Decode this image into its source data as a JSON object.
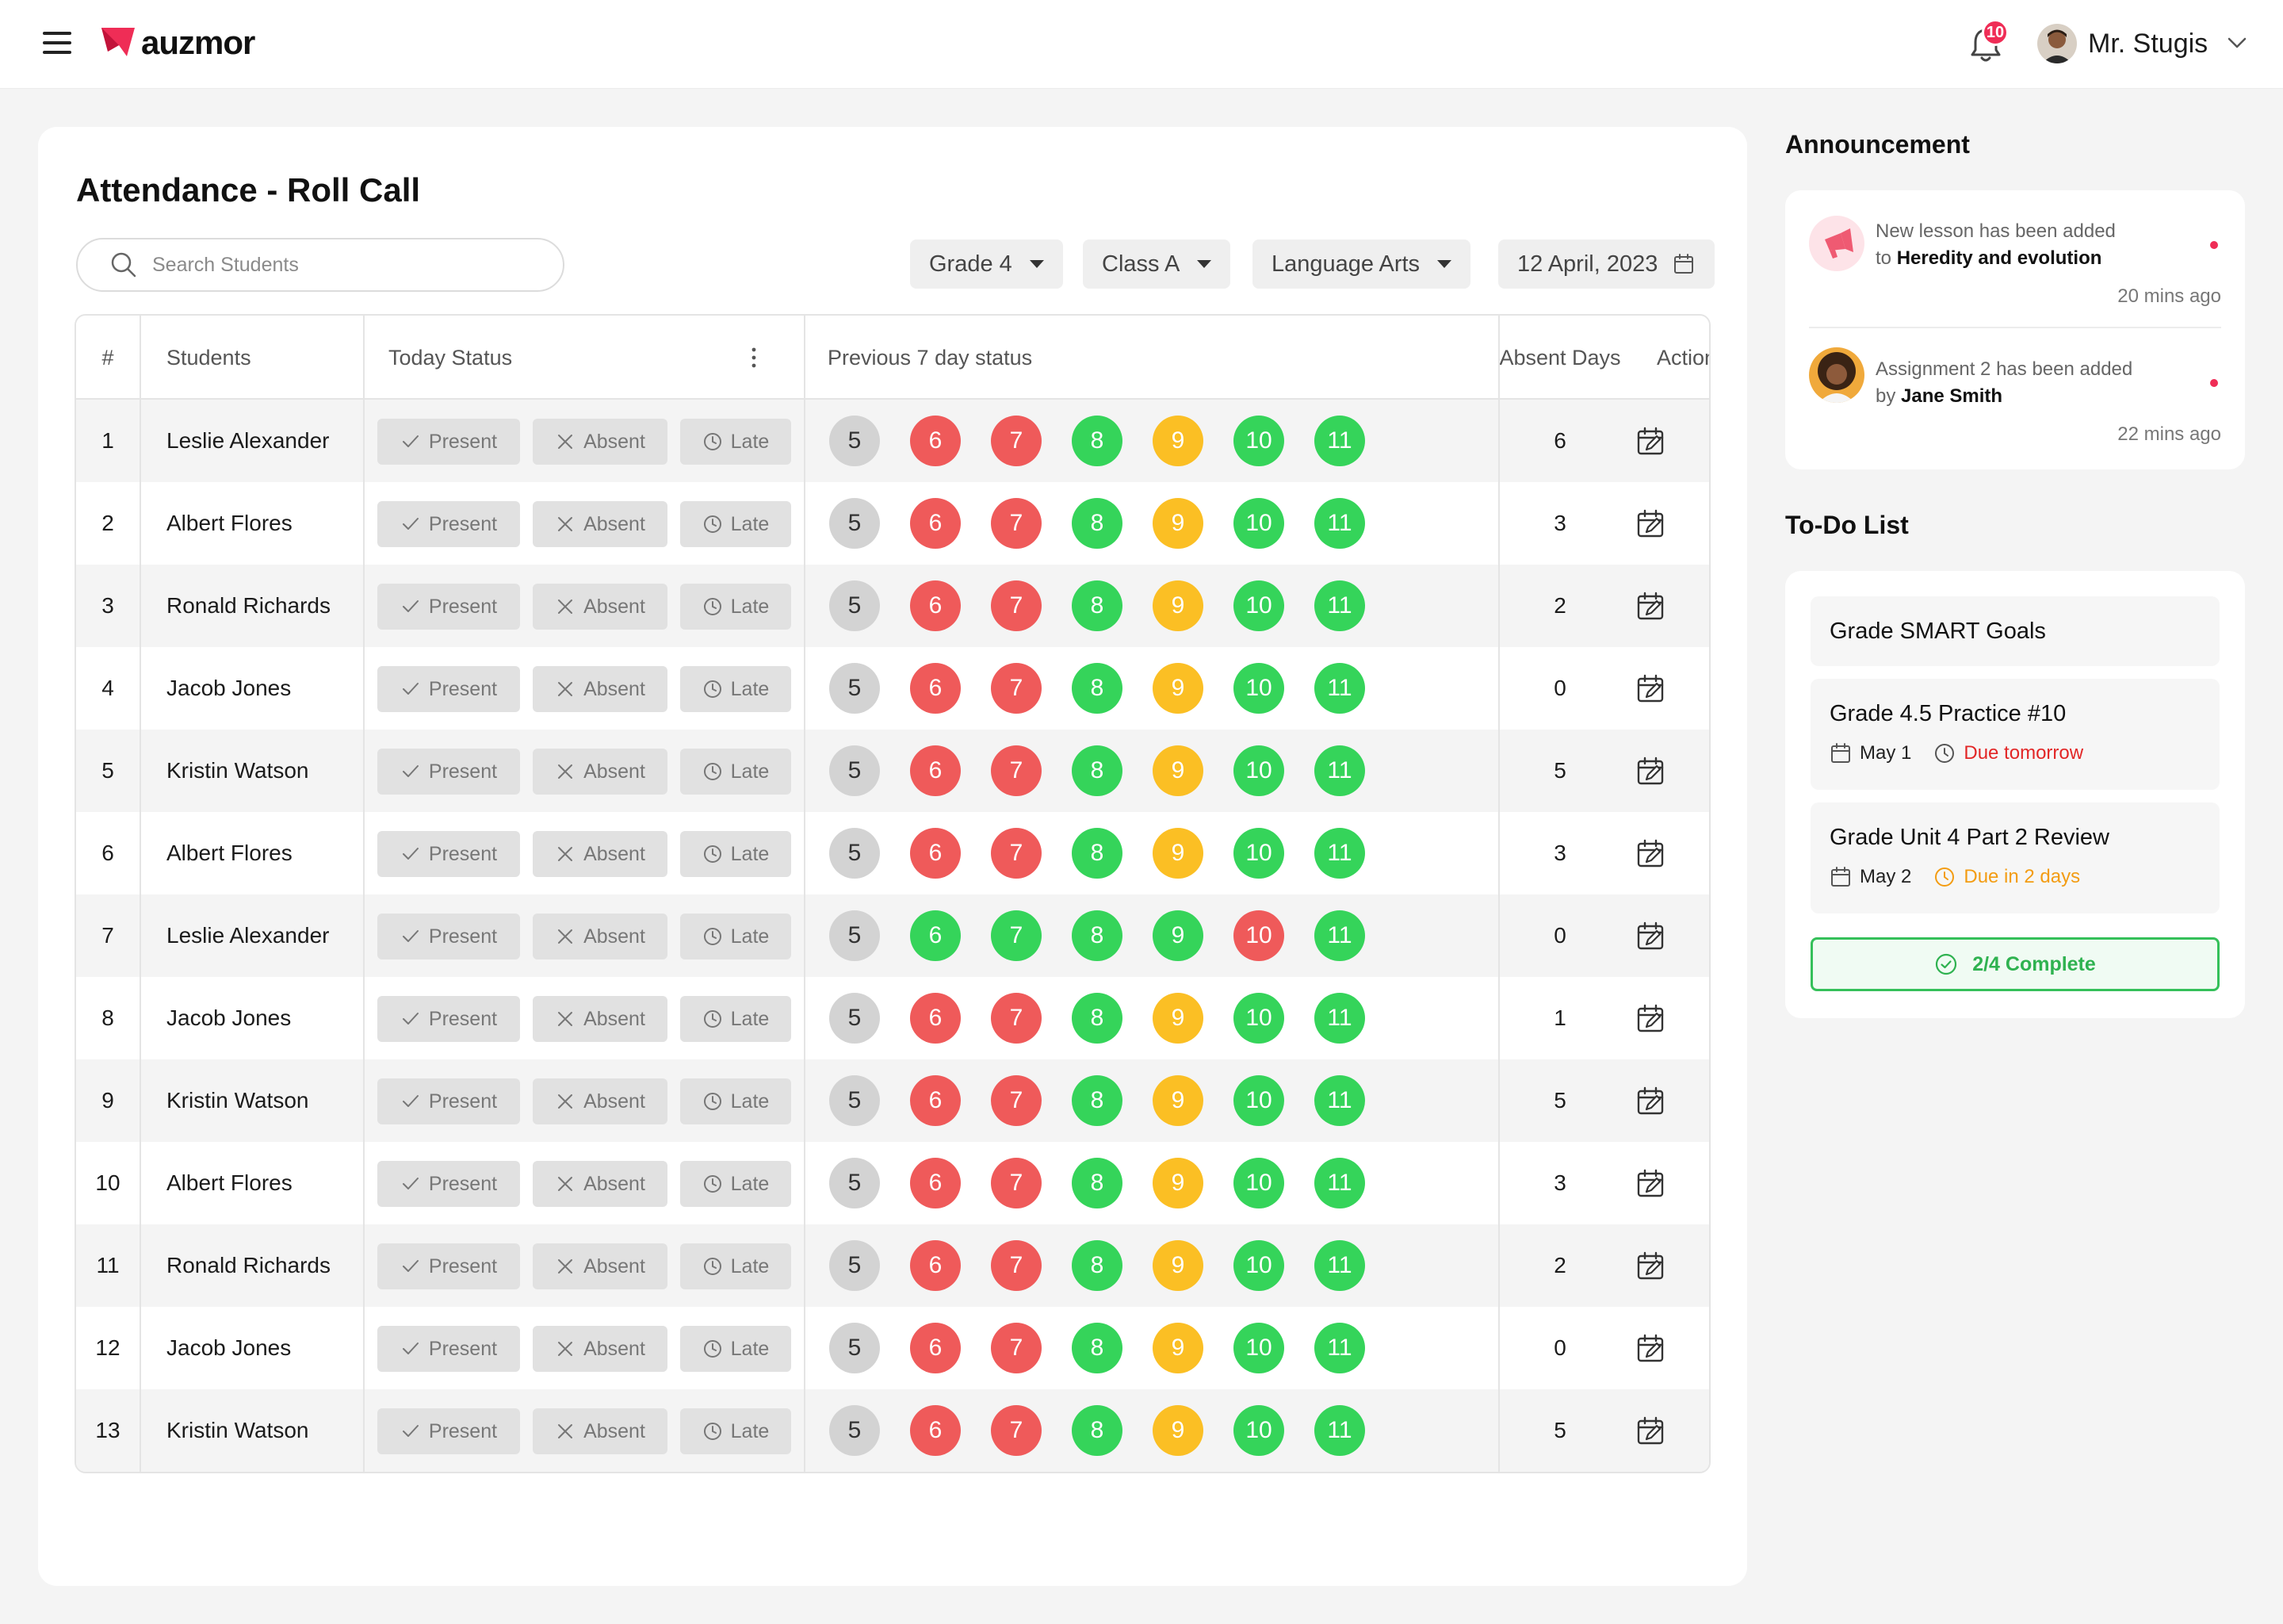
{
  "header": {
    "brand": "auzmor",
    "notifications_count": "10",
    "user_name": "Mr. Stugis"
  },
  "page": {
    "title": "Attendance - Roll Call",
    "search_placeholder": "Search Students",
    "filters": {
      "grade": "Grade 4",
      "class": "Class A",
      "subject": "Language Arts",
      "date": "12 April, 2023"
    }
  },
  "table": {
    "headers": {
      "index": "#",
      "students": "Students",
      "today_status": "Today Status",
      "previous_status": "Previous 7 day status",
      "absent_days": "Absent Days",
      "action": "Action"
    },
    "status_labels": {
      "present": "Present",
      "absent": "Absent",
      "late": "Late"
    },
    "day_labels": [
      "5",
      "6",
      "7",
      "8",
      "9",
      "10",
      "11"
    ],
    "colors": {
      "gray": "#d3d3d3",
      "red": "#ef5a5a",
      "green": "#35d45a",
      "yellow": "#fbbf24"
    },
    "rows": [
      {
        "index": "1",
        "name": "Leslie Alexander",
        "absent_days": "6",
        "days": [
          "gray",
          "red",
          "red",
          "green",
          "yellow",
          "green",
          "green"
        ]
      },
      {
        "index": "2",
        "name": "Albert Flores",
        "absent_days": "3",
        "days": [
          "gray",
          "red",
          "red",
          "green",
          "yellow",
          "green",
          "green"
        ]
      },
      {
        "index": "3",
        "name": "Ronald Richards",
        "absent_days": "2",
        "days": [
          "gray",
          "red",
          "red",
          "green",
          "yellow",
          "green",
          "green"
        ]
      },
      {
        "index": "4",
        "name": "Jacob Jones",
        "absent_days": "0",
        "days": [
          "gray",
          "red",
          "red",
          "green",
          "yellow",
          "green",
          "green"
        ]
      },
      {
        "index": "5",
        "name": "Kristin Watson",
        "absent_days": "5",
        "days": [
          "gray",
          "red",
          "red",
          "green",
          "yellow",
          "green",
          "green"
        ]
      },
      {
        "index": "6",
        "name": "Albert Flores",
        "absent_days": "3",
        "days": [
          "gray",
          "red",
          "red",
          "green",
          "yellow",
          "green",
          "green"
        ]
      },
      {
        "index": "7",
        "name": "Leslie Alexander",
        "absent_days": "0",
        "days": [
          "gray",
          "green",
          "green",
          "green",
          "green",
          "red",
          "green"
        ]
      },
      {
        "index": "8",
        "name": "Jacob Jones",
        "absent_days": "1",
        "days": [
          "gray",
          "red",
          "red",
          "green",
          "yellow",
          "green",
          "green"
        ]
      },
      {
        "index": "9",
        "name": "Kristin Watson",
        "absent_days": "5",
        "days": [
          "gray",
          "red",
          "red",
          "green",
          "yellow",
          "green",
          "green"
        ]
      },
      {
        "index": "10",
        "name": "Albert Flores",
        "absent_days": "3",
        "days": [
          "gray",
          "red",
          "red",
          "green",
          "yellow",
          "green",
          "green"
        ]
      },
      {
        "index": "11",
        "name": "Ronald Richards",
        "absent_days": "2",
        "days": [
          "gray",
          "red",
          "red",
          "green",
          "yellow",
          "green",
          "green"
        ]
      },
      {
        "index": "12",
        "name": "Jacob Jones",
        "absent_days": "0",
        "days": [
          "gray",
          "red",
          "red",
          "green",
          "yellow",
          "green",
          "green"
        ]
      },
      {
        "index": "13",
        "name": "Kristin Watson",
        "absent_days": "5",
        "days": [
          "gray",
          "red",
          "red",
          "green",
          "yellow",
          "green",
          "green"
        ]
      }
    ]
  },
  "announcements": {
    "title": "Announcement",
    "items": [
      {
        "line1": "New lesson has been added",
        "prefix": "to",
        "highlight": "Heredity and evolution",
        "time": "20 mins ago"
      },
      {
        "line1": "Assignment 2 has been added",
        "prefix": "by",
        "highlight": "Jane Smith",
        "time": "22 mins ago"
      }
    ]
  },
  "todo": {
    "title": "To-Do List",
    "items": [
      {
        "title": "Grade SMART Goals"
      },
      {
        "title": "Grade 4.5 Practice #10",
        "date": "May 1",
        "due": "Due tomorrow"
      },
      {
        "title": "Grade Unit 4 Part 2 Review",
        "date": "May 2",
        "due": "Due in 2 days"
      }
    ],
    "complete_label": "2/4 Complete"
  }
}
